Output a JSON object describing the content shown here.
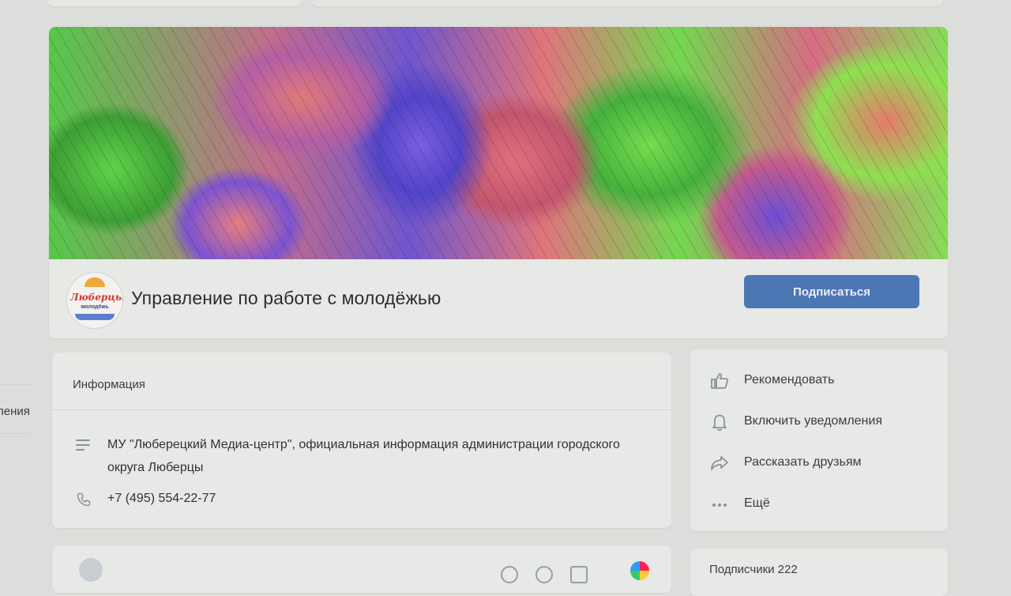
{
  "colors": {
    "accent": "#4d76b4",
    "page_bg": "#dcdedb",
    "card_bg": "#e7e9e6"
  },
  "sidebar": {
    "partial_label": "ления"
  },
  "group": {
    "title": "Управление по работе с молодёжью",
    "avatar_logo_text": "Люберцы",
    "avatar_logo_subtext": "молодёжь",
    "subscribe_label": "Подписаться"
  },
  "info": {
    "header": "Информация",
    "description": "МУ \"Люберецкий Медиа-центр\", официальная информация администрации городского округа Люберцы",
    "phone": "+7 (495) 554-22-77"
  },
  "actions": [
    {
      "label": "Рекомендовать",
      "icon": "thumbs-up-icon"
    },
    {
      "label": "Включить уведомления",
      "icon": "bell-icon"
    },
    {
      "label": "Рассказать друзьям",
      "icon": "share-icon"
    },
    {
      "label": "Ещё",
      "icon": "more-icon"
    }
  ],
  "subscribers": {
    "label": "Подписчики 222"
  }
}
